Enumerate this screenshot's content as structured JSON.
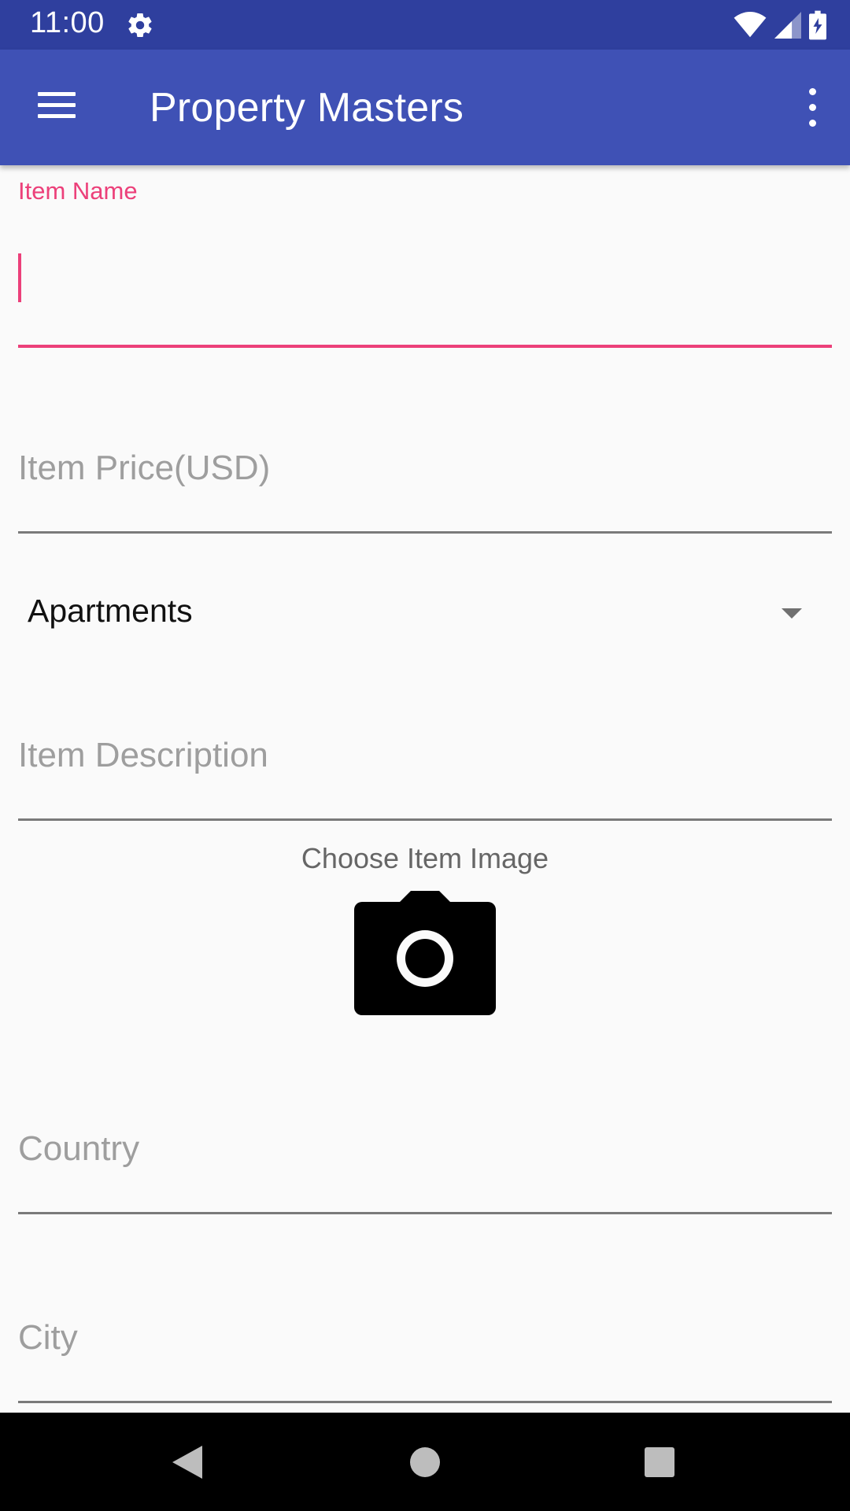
{
  "status_bar": {
    "time": "11:00",
    "icons": [
      "gear-icon",
      "wifi-icon",
      "signal-icon",
      "battery-charging-icon"
    ]
  },
  "app_bar": {
    "title": "Property Masters",
    "menu_icon": "hamburger-menu-icon",
    "overflow_icon": "more-vertical-icon",
    "color": "#3f51b5",
    "status_color": "#2f3f9e"
  },
  "form": {
    "item_name": {
      "label": "Item Name",
      "value": ""
    },
    "item_price": {
      "placeholder": "Item Price(USD)"
    },
    "category": {
      "selected": "Apartments"
    },
    "item_description": {
      "placeholder": "Item Description"
    },
    "image": {
      "label": "Choose Item Image",
      "icon": "camera-icon"
    },
    "country": {
      "placeholder": "Country"
    },
    "city": {
      "placeholder": "City"
    },
    "accent_color": "#ec407a"
  },
  "nav_bar": {
    "back_icon": "back-triangle-icon",
    "home_icon": "home-circle-icon",
    "recents_icon": "recents-square-icon"
  }
}
